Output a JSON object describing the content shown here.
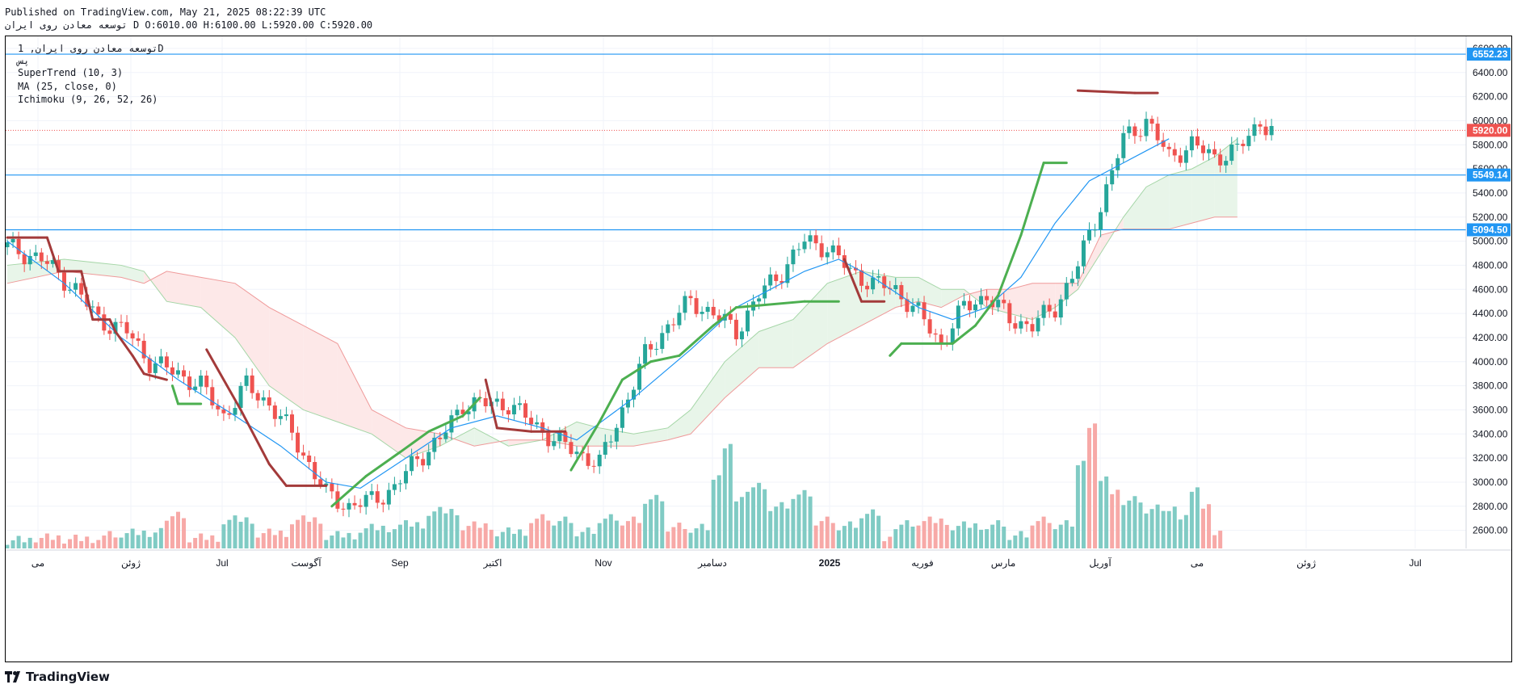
{
  "header": {
    "published": "Published on TradingView.com, May 21, 2025 08:22:39 UTC",
    "ohlc": "توسعه معادن روی ایران D O:6010.00 H:6100.00 L:5920.00 C:5920.00"
  },
  "legend": {
    "symbol": "توسعه معادن روی ایران, 1D",
    "exchange": "پس",
    "indicators": [
      "SuperTrend (10, 3)",
      "MA (25, close, 0)",
      "Ichimoku (9, 26, 52, 26)"
    ]
  },
  "footer": {
    "brand": "TradingView"
  },
  "colors": {
    "up": "#26a69a",
    "down": "#ef5350",
    "supertrend_up": "#4caf50",
    "supertrend_down": "#a33a3a",
    "ma": "#2196f3",
    "hline": "#2196f3",
    "last_price": "#ef5350",
    "cloud_green": "#e8f5e9",
    "cloud_red": "#fde8e8"
  },
  "chart_data": {
    "type": "candlestick",
    "y_axis": {
      "min": 2450,
      "max": 6700,
      "ticks": [
        2600,
        2800,
        3000,
        3200,
        3400,
        3600,
        3800,
        4000,
        4200,
        4400,
        4600,
        4800,
        5000,
        5200,
        5400,
        5600,
        5800,
        6000,
        6200,
        6400,
        6600
      ]
    },
    "x_axis": {
      "ticks": [
        "می",
        "ژوئن",
        "Jul",
        "آگوست",
        "Sep",
        "اکتبر",
        "Nov",
        "دسامبر",
        "2025",
        "فوریه",
        "مارس",
        "آوریل",
        "می",
        "ژوئن",
        "Jul"
      ]
    },
    "horizontal_lines": [
      {
        "value": 6552.23,
        "label": "6552.23"
      },
      {
        "value": 5549.14,
        "label": "5549.14"
      },
      {
        "value": 5094.5,
        "label": "5094.50"
      }
    ],
    "last_price": {
      "value": 5920.0,
      "label": "5920.00"
    },
    "price_path": [
      [
        0,
        4950
      ],
      [
        6,
        4850
      ],
      [
        12,
        4600
      ],
      [
        16,
        4350
      ],
      [
        21,
        4250
      ],
      [
        25,
        4000
      ],
      [
        30,
        3900
      ],
      [
        34,
        3800
      ],
      [
        38,
        3550
      ],
      [
        42,
        3800
      ],
      [
        46,
        3650
      ],
      [
        50,
        3400
      ],
      [
        53,
        3150
      ],
      [
        56,
        2900
      ],
      [
        60,
        2800
      ],
      [
        64,
        2850
      ],
      [
        68,
        2950
      ],
      [
        72,
        3200
      ],
      [
        76,
        3350
      ],
      [
        80,
        3650
      ],
      [
        84,
        3650
      ],
      [
        88,
        3650
      ],
      [
        92,
        3500
      ],
      [
        96,
        3350
      ],
      [
        100,
        3250
      ],
      [
        104,
        3150
      ],
      [
        108,
        3600
      ],
      [
        112,
        4050
      ],
      [
        116,
        4300
      ],
      [
        120,
        4500
      ],
      [
        124,
        4400
      ],
      [
        128,
        4250
      ],
      [
        132,
        4550
      ],
      [
        136,
        4750
      ],
      [
        140,
        5000
      ],
      [
        144,
        4950
      ],
      [
        148,
        4750
      ],
      [
        152,
        4650
      ],
      [
        156,
        4600
      ],
      [
        160,
        4400
      ],
      [
        164,
        4150
      ],
      [
        168,
        4450
      ],
      [
        172,
        4550
      ],
      [
        176,
        4350
      ],
      [
        180,
        4300
      ],
      [
        184,
        4450
      ],
      [
        188,
        4800
      ],
      [
        192,
        5300
      ],
      [
        196,
        5850
      ],
      [
        200,
        6000
      ],
      [
        204,
        5700
      ],
      [
        208,
        5800
      ],
      [
        212,
        5700
      ],
      [
        216,
        5750
      ],
      [
        220,
        6000
      ],
      [
        222,
        5920
      ]
    ],
    "supertrend": [
      [
        0,
        5030,
        "down"
      ],
      [
        7,
        5030,
        "down"
      ],
      [
        9,
        4750,
        "down"
      ],
      [
        13,
        4750,
        "down"
      ],
      [
        15,
        4350,
        "down"
      ],
      [
        18,
        4350,
        "down"
      ],
      [
        19,
        4250,
        "down"
      ],
      [
        22,
        4050,
        "down"
      ],
      [
        24,
        3900,
        "down"
      ],
      [
        28,
        3850,
        "down"
      ],
      [
        29,
        3800,
        "up"
      ],
      [
        30,
        3650,
        "up"
      ],
      [
        34,
        3650,
        "up"
      ],
      [
        35,
        4100,
        "down"
      ],
      [
        41,
        3600,
        "down"
      ],
      [
        46,
        3150,
        "down"
      ],
      [
        49,
        2970,
        "down"
      ],
      [
        56,
        2970,
        "down"
      ],
      [
        57,
        2800,
        "up"
      ],
      [
        63,
        3050,
        "up"
      ],
      [
        69,
        3250,
        "up"
      ],
      [
        74,
        3420,
        "up"
      ],
      [
        80,
        3550,
        "up"
      ],
      [
        83,
        3700,
        "up"
      ],
      [
        84,
        3850,
        "down"
      ],
      [
        86,
        3450,
        "down"
      ],
      [
        92,
        3420,
        "down"
      ],
      [
        98,
        3420,
        "down"
      ],
      [
        99,
        3100,
        "up"
      ],
      [
        104,
        3500,
        "up"
      ],
      [
        108,
        3850,
        "up"
      ],
      [
        113,
        4000,
        "up"
      ],
      [
        118,
        4050,
        "up"
      ],
      [
        124,
        4300,
        "up"
      ],
      [
        128,
        4450,
        "up"
      ],
      [
        140,
        4500,
        "up"
      ],
      [
        146,
        4500,
        "up"
      ],
      [
        147,
        4850,
        "down"
      ],
      [
        150,
        4500,
        "down"
      ],
      [
        154,
        4500,
        "down"
      ],
      [
        155,
        4050,
        "up"
      ],
      [
        157,
        4150,
        "up"
      ],
      [
        166,
        4150,
        "up"
      ],
      [
        170,
        4300,
        "up"
      ],
      [
        174,
        4550,
        "up"
      ],
      [
        178,
        5050,
        "up"
      ],
      [
        182,
        5650,
        "up"
      ],
      [
        186,
        5650,
        "up"
      ],
      [
        188,
        6250,
        "down"
      ],
      [
        198,
        6230,
        "down"
      ],
      [
        202,
        6230,
        "down"
      ]
    ],
    "ma": [
      [
        0,
        5000
      ],
      [
        10,
        4650
      ],
      [
        20,
        4200
      ],
      [
        30,
        3850
      ],
      [
        40,
        3550
      ],
      [
        48,
        3300
      ],
      [
        56,
        3000
      ],
      [
        62,
        2950
      ],
      [
        70,
        3200
      ],
      [
        78,
        3450
      ],
      [
        86,
        3550
      ],
      [
        94,
        3450
      ],
      [
        100,
        3350
      ],
      [
        110,
        3700
      ],
      [
        120,
        4100
      ],
      [
        128,
        4450
      ],
      [
        136,
        4650
      ],
      [
        140,
        4750
      ],
      [
        146,
        4850
      ],
      [
        152,
        4700
      ],
      [
        160,
        4450
      ],
      [
        166,
        4350
      ],
      [
        172,
        4450
      ],
      [
        178,
        4700
      ],
      [
        184,
        5150
      ],
      [
        190,
        5500
      ],
      [
        196,
        5650
      ],
      [
        200,
        5750
      ],
      [
        204,
        5850
      ]
    ],
    "cloud": [
      [
        0,
        4800,
        4650
      ],
      [
        10,
        4850,
        4750
      ],
      [
        20,
        4800,
        4700
      ],
      [
        24,
        4750,
        4650
      ],
      [
        28,
        4500,
        4750
      ],
      [
        34,
        4450,
        4700
      ],
      [
        40,
        4200,
        4650
      ],
      [
        46,
        3800,
        4450
      ],
      [
        52,
        3600,
        4300
      ],
      [
        58,
        3500,
        4150
      ],
      [
        64,
        3400,
        3600
      ],
      [
        70,
        3200,
        3450
      ],
      [
        76,
        3300,
        3400
      ],
      [
        82,
        3450,
        3300
      ],
      [
        88,
        3300,
        3350
      ],
      [
        94,
        3350,
        3350
      ],
      [
        100,
        3500,
        3300
      ],
      [
        104,
        3450,
        3300
      ],
      [
        110,
        3400,
        3300
      ],
      [
        116,
        3450,
        3350
      ],
      [
        120,
        3600,
        3400
      ],
      [
        126,
        4000,
        3700
      ],
      [
        132,
        4250,
        3950
      ],
      [
        138,
        4350,
        3950
      ],
      [
        144,
        4650,
        4150
      ],
      [
        150,
        4750,
        4300
      ],
      [
        156,
        4700,
        4450
      ],
      [
        160,
        4700,
        4500
      ],
      [
        164,
        4600,
        4450
      ],
      [
        168,
        4600,
        4550
      ],
      [
        172,
        4450,
        4600
      ],
      [
        176,
        4400,
        4600
      ],
      [
        180,
        4350,
        4650
      ],
      [
        184,
        4450,
        4650
      ],
      [
        188,
        4600,
        4650
      ],
      [
        192,
        4900,
        5050
      ],
      [
        196,
        5200,
        5100
      ],
      [
        200,
        5450,
        5100
      ],
      [
        204,
        5550,
        5100
      ],
      [
        208,
        5600,
        5150
      ],
      [
        212,
        5700,
        5200
      ],
      [
        216,
        5850,
        5200
      ]
    ],
    "volume": [
      [
        0,
        2520,
        "up"
      ],
      [
        5,
        2540,
        "down"
      ],
      [
        10,
        2530,
        "down"
      ],
      [
        16,
        2560,
        "down"
      ],
      [
        20,
        2580,
        "up"
      ],
      [
        28,
        2720,
        "down"
      ],
      [
        32,
        2540,
        "down"
      ],
      [
        38,
        2690,
        "up"
      ],
      [
        44,
        2580,
        "down"
      ],
      [
        50,
        2690,
        "down"
      ],
      [
        56,
        2560,
        "up"
      ],
      [
        62,
        2620,
        "up"
      ],
      [
        68,
        2650,
        "up"
      ],
      [
        74,
        2760,
        "up"
      ],
      [
        80,
        2640,
        "down"
      ],
      [
        86,
        2590,
        "up"
      ],
      [
        92,
        2700,
        "down"
      ],
      [
        96,
        2680,
        "up"
      ],
      [
        100,
        2590,
        "up"
      ],
      [
        104,
        2700,
        "up"
      ],
      [
        108,
        2680,
        "down"
      ],
      [
        112,
        2860,
        "up"
      ],
      [
        116,
        2630,
        "down"
      ],
      [
        120,
        2620,
        "up"
      ],
      [
        124,
        3060,
        "up"
      ],
      [
        126,
        3320,
        "up"
      ],
      [
        128,
        2880,
        "up"
      ],
      [
        130,
        2960,
        "up"
      ],
      [
        134,
        2800,
        "up"
      ],
      [
        138,
        2900,
        "up"
      ],
      [
        142,
        2680,
        "down"
      ],
      [
        146,
        2640,
        "up"
      ],
      [
        150,
        2740,
        "up"
      ],
      [
        154,
        2550,
        "down"
      ],
      [
        156,
        2650,
        "up"
      ],
      [
        160,
        2680,
        "down"
      ],
      [
        166,
        2640,
        "up"
      ],
      [
        172,
        2650,
        "up"
      ],
      [
        176,
        2560,
        "up"
      ],
      [
        180,
        2680,
        "down"
      ],
      [
        184,
        2650,
        "up"
      ],
      [
        188,
        3180,
        "up"
      ],
      [
        190,
        3490,
        "down"
      ],
      [
        192,
        3050,
        "up"
      ],
      [
        194,
        2940,
        "down"
      ],
      [
        196,
        2850,
        "up"
      ],
      [
        200,
        2780,
        "up"
      ],
      [
        204,
        2800,
        "up"
      ],
      [
        206,
        2730,
        "up"
      ],
      [
        208,
        2960,
        "up"
      ],
      [
        210,
        2820,
        "down"
      ],
      [
        212,
        2600,
        "down"
      ]
    ]
  }
}
